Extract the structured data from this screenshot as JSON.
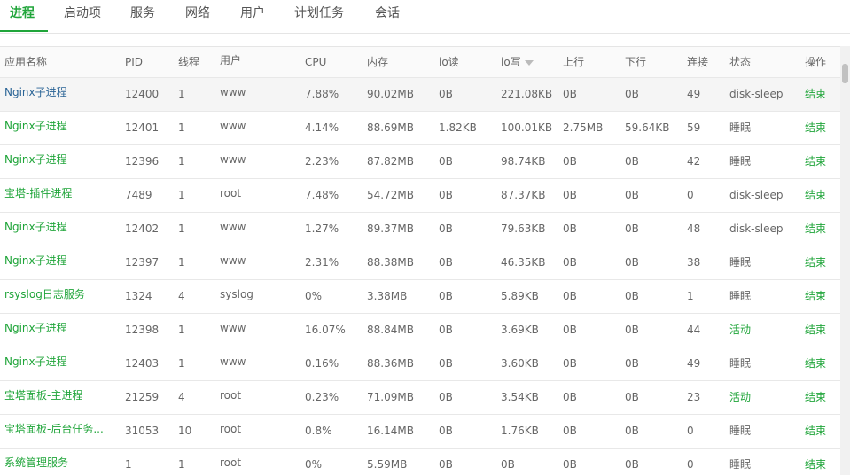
{
  "tabs": [
    "进程",
    "启动项",
    "服务",
    "网络",
    "用户",
    "计划任务",
    "会话"
  ],
  "headers": [
    "应用名称",
    "PID",
    "线程",
    "用户",
    "CPU",
    "内存",
    "io读",
    "io写",
    "上行",
    "下行",
    "连接",
    "状态",
    "操作"
  ],
  "sorted_column": "io写",
  "rows": [
    {
      "name": "Nginx子进程",
      "pid": "12400",
      "threads": "1",
      "user": "www",
      "cpu": "7.88%",
      "mem": "90.02MB",
      "io_read": "0B",
      "io_write": "221.08KB",
      "up": "0B",
      "down": "0B",
      "conn": "49",
      "state": "disk-sleep",
      "action": "结束"
    },
    {
      "name": "Nginx子进程",
      "pid": "12401",
      "threads": "1",
      "user": "www",
      "cpu": "4.14%",
      "mem": "88.69MB",
      "io_read": "1.82KB",
      "io_write": "100.01KB",
      "up": "2.75MB",
      "down": "59.64KB",
      "conn": "59",
      "state": "睡眠",
      "action": "结束"
    },
    {
      "name": "Nginx子进程",
      "pid": "12396",
      "threads": "1",
      "user": "www",
      "cpu": "2.23%",
      "mem": "87.82MB",
      "io_read": "0B",
      "io_write": "98.74KB",
      "up": "0B",
      "down": "0B",
      "conn": "42",
      "state": "睡眠",
      "action": "结束"
    },
    {
      "name": "宝塔-插件进程",
      "pid": "7489",
      "threads": "1",
      "user": "root",
      "cpu": "7.48%",
      "mem": "54.72MB",
      "io_read": "0B",
      "io_write": "87.37KB",
      "up": "0B",
      "down": "0B",
      "conn": "0",
      "state": "disk-sleep",
      "action": "结束"
    },
    {
      "name": "Nginx子进程",
      "pid": "12402",
      "threads": "1",
      "user": "www",
      "cpu": "1.27%",
      "mem": "89.37MB",
      "io_read": "0B",
      "io_write": "79.63KB",
      "up": "0B",
      "down": "0B",
      "conn": "48",
      "state": "disk-sleep",
      "action": "结束"
    },
    {
      "name": "Nginx子进程",
      "pid": "12397",
      "threads": "1",
      "user": "www",
      "cpu": "2.31%",
      "mem": "88.38MB",
      "io_read": "0B",
      "io_write": "46.35KB",
      "up": "0B",
      "down": "0B",
      "conn": "38",
      "state": "睡眠",
      "action": "结束"
    },
    {
      "name": "rsyslog日志服务",
      "pid": "1324",
      "threads": "4",
      "user": "syslog",
      "cpu": "0%",
      "mem": "3.38MB",
      "io_read": "0B",
      "io_write": "5.89KB",
      "up": "0B",
      "down": "0B",
      "conn": "1",
      "state": "睡眠",
      "action": "结束"
    },
    {
      "name": "Nginx子进程",
      "pid": "12398",
      "threads": "1",
      "user": "www",
      "cpu": "16.07%",
      "mem": "88.84MB",
      "io_read": "0B",
      "io_write": "3.69KB",
      "up": "0B",
      "down": "0B",
      "conn": "44",
      "state": "活动",
      "action": "结束"
    },
    {
      "name": "Nginx子进程",
      "pid": "12403",
      "threads": "1",
      "user": "www",
      "cpu": "0.16%",
      "mem": "88.36MB",
      "io_read": "0B",
      "io_write": "3.60KB",
      "up": "0B",
      "down": "0B",
      "conn": "49",
      "state": "睡眠",
      "action": "结束"
    },
    {
      "name": "宝塔面板-主进程",
      "pid": "21259",
      "threads": "4",
      "user": "root",
      "cpu": "0.23%",
      "mem": "71.09MB",
      "io_read": "0B",
      "io_write": "3.54KB",
      "up": "0B",
      "down": "0B",
      "conn": "23",
      "state": "活动",
      "action": "结束"
    },
    {
      "name": "宝塔面板-后台任务...",
      "pid": "31053",
      "threads": "10",
      "user": "root",
      "cpu": "0.8%",
      "mem": "16.14MB",
      "io_read": "0B",
      "io_write": "1.76KB",
      "up": "0B",
      "down": "0B",
      "conn": "0",
      "state": "睡眠",
      "action": "结束"
    },
    {
      "name": "系统管理服务",
      "pid": "1",
      "threads": "1",
      "user": "root",
      "cpu": "0%",
      "mem": "5.59MB",
      "io_read": "0B",
      "io_write": "0B",
      "up": "0B",
      "down": "0B",
      "conn": "0",
      "state": "睡眠",
      "action": "结束"
    }
  ]
}
